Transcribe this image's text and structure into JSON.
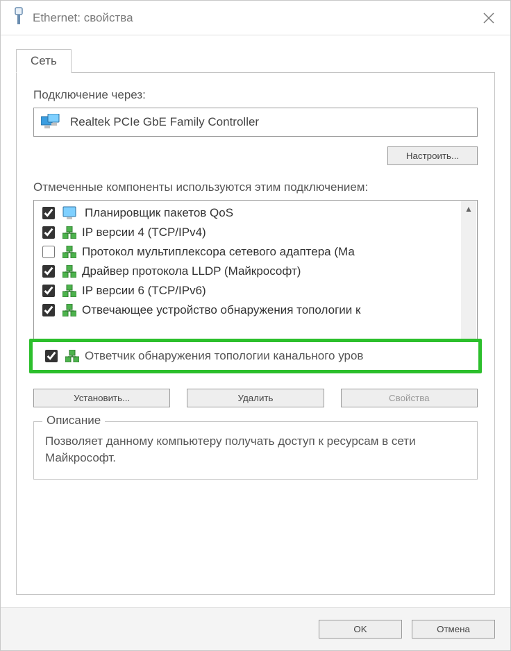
{
  "titlebar": {
    "title": "Ethernet: свойства"
  },
  "tab": {
    "label": "Сеть"
  },
  "connection": {
    "label": "Подключение через:",
    "adapter": "Realtek PCIe GbE Family Controller",
    "configure_btn": "Настроить..."
  },
  "components": {
    "label": "Отмеченные компоненты используются этим подключением:",
    "items": [
      {
        "checked": true,
        "icon": "monitor",
        "label": "Планировщик пакетов QoS"
      },
      {
        "checked": true,
        "icon": "proto",
        "label": "IP версии 4 (TCP/IPv4)"
      },
      {
        "checked": false,
        "icon": "proto",
        "label": "Протокол мультиплексора сетевого адаптера (Ма"
      },
      {
        "checked": true,
        "icon": "proto",
        "label": "Драйвер протокола LLDP (Майкрософт)"
      },
      {
        "checked": true,
        "icon": "proto",
        "label": "IP версии 6 (TCP/IPv6)"
      },
      {
        "checked": true,
        "icon": "proto",
        "label": "Отвечающее устройство обнаружения топологии к"
      }
    ],
    "highlighted": {
      "checked": true,
      "label": "Ответчик обнаружения топологии канального уров"
    }
  },
  "buttons": {
    "install": "Установить...",
    "remove": "Удалить",
    "properties": "Свойства"
  },
  "description": {
    "legend": "Описание",
    "text": "Позволяет данному компьютеру получать доступ к ресурсам в сети Майкрософт."
  },
  "footer": {
    "ok": "OK",
    "cancel": "Отмена"
  }
}
